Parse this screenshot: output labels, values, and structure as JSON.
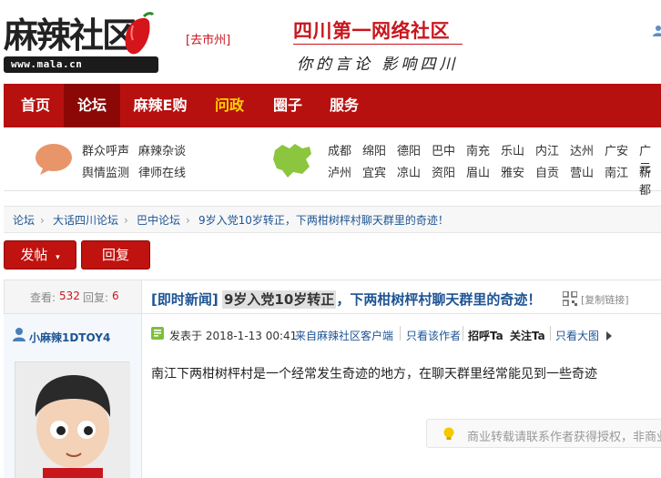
{
  "header": {
    "logo_text": "麻辣社区",
    "logo_url": "www.mala.cn",
    "city_switch": "[去市州]",
    "slogan_main": "四川第一网络社区",
    "slogan_sub": "你的言论 影响四川"
  },
  "nav": {
    "items": [
      "首页",
      "论坛",
      "麻辣E购",
      "问政",
      "圈子",
      "服务"
    ]
  },
  "quick_links": {
    "links": [
      "群众呼声",
      "麻辣杂谈",
      "舆情监测",
      "律师在线"
    ],
    "cities_row1": [
      "成都",
      "绵阳",
      "德阳",
      "巴中",
      "南充",
      "乐山",
      "内江",
      "达州",
      "广安",
      "广元"
    ],
    "cities_row2": [
      "泸州",
      "宜宾",
      "凉山",
      "资阳",
      "眉山",
      "雅安",
      "自贡",
      "营山",
      "南江",
      "新都"
    ]
  },
  "breadcrumb": {
    "items": [
      "论坛",
      "大话四川论坛",
      "巴中论坛",
      "9岁入党10岁转正，下两柑树枰村聊天群里的奇迹！"
    ],
    "sep": "›"
  },
  "actions": {
    "post_label": "发帖",
    "reply_label": "回复"
  },
  "thread": {
    "views_label": "查看:",
    "views": "532",
    "replies_label": "回复:",
    "replies": "6",
    "tag": "[即时新闻]",
    "title_highlight": "9岁入党10岁转正",
    "title_rest": "，下两柑树枰村聊天群里的奇迹！",
    "copy_link": "[复制链接]"
  },
  "author": {
    "name": "小麻辣1DTOY4"
  },
  "post": {
    "posted_at": "发表于 2018-1-13 00:41",
    "client_link": "来自麻辣社区客户端",
    "only_author": "只看该作者",
    "greet": "招呼Ta",
    "follow": "关注Ta",
    "big_image": "只看大图",
    "content": "南江下两柑树枰村是一个经常发生奇迹的地方，在聊天群里经常能见到一些奇迹",
    "notice": "商业转载请联系作者获得授权，非商业"
  },
  "colors": {
    "brand_red": "#b7110f",
    "nav_active": "#8c0806",
    "link_blue": "#1e5494",
    "highlight_yellow": "#ffd200"
  }
}
